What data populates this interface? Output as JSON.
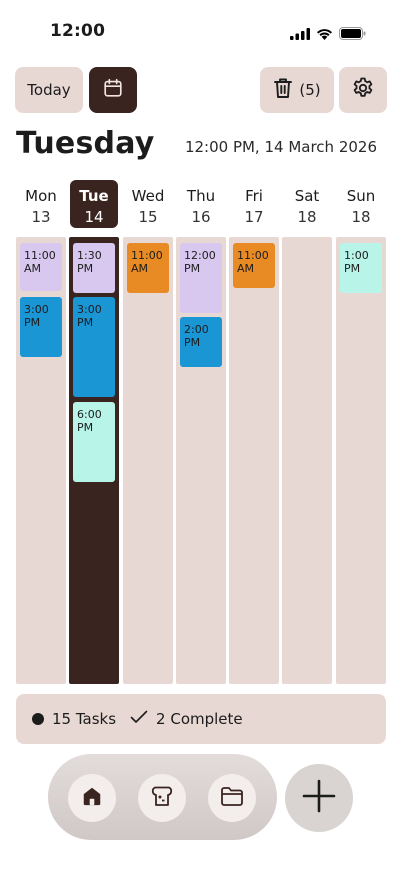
{
  "status_bar": {
    "time": "12:00",
    "icons": [
      "signal-icon",
      "wifi-icon",
      "battery-icon"
    ]
  },
  "toolbar": {
    "today_label": "Today",
    "calendar_icon": "calendar-icon",
    "trash_icon": "trash-icon",
    "trash_count": "(5)",
    "settings_icon": "gear-icon"
  },
  "header": {
    "day_title": "Tuesday",
    "datetime": "12:00 PM, 14 March 2026"
  },
  "days": [
    {
      "name": "Mon",
      "num": "13",
      "active": false,
      "events": [
        {
          "time": "11:00 AM",
          "color": "lavender"
        },
        {
          "time": "3:00 PM",
          "color": "blue"
        }
      ]
    },
    {
      "name": "Tue",
      "num": "14",
      "active": true,
      "events": [
        {
          "time": "1:30 PM",
          "color": "lavender"
        },
        {
          "time": "3:00 PM",
          "color": "blue"
        },
        {
          "time": "6:00 PM",
          "color": "mint"
        }
      ]
    },
    {
      "name": "Wed",
      "num": "15",
      "active": false,
      "events": [
        {
          "time": "11:00 AM",
          "color": "orange"
        }
      ]
    },
    {
      "name": "Thu",
      "num": "16",
      "active": false,
      "events": [
        {
          "time": "12:00 PM",
          "color": "lavender"
        },
        {
          "time": "2:00 PM",
          "color": "blue"
        }
      ]
    },
    {
      "name": "Fri",
      "num": "17",
      "active": false,
      "events": [
        {
          "time": "11:00 AM",
          "color": "orange"
        }
      ]
    },
    {
      "name": "Sat",
      "num": "18",
      "active": false,
      "events": []
    },
    {
      "name": "Sun",
      "num": "18",
      "active": false,
      "events": [
        {
          "time": "1:00 PM",
          "color": "mint"
        }
      ]
    }
  ],
  "colors": {
    "accent_dark": "#3a2420",
    "surface": "#e8d8d3",
    "lavender": "#d8c8f0",
    "blue": "#1a96d4",
    "orange": "#e98b25",
    "mint": "#b8f5e8"
  },
  "summary": {
    "tasks": "15 Tasks",
    "complete": "2 Complete"
  },
  "bottom_nav": {
    "items": [
      "home-icon",
      "bread-icon",
      "folder-icon"
    ],
    "add_icon": "plus-icon"
  }
}
